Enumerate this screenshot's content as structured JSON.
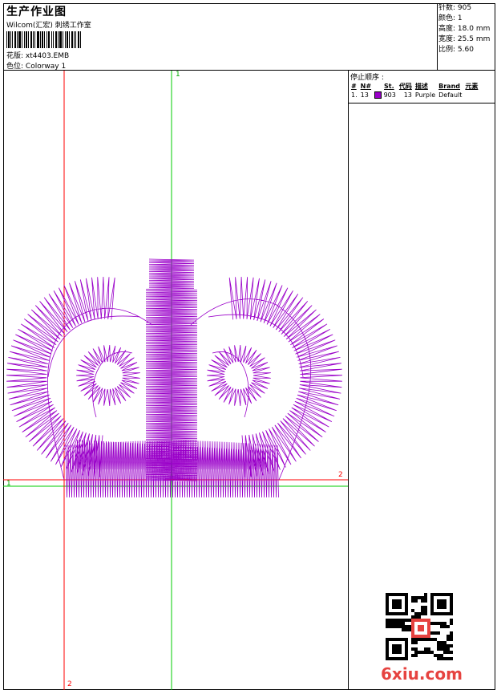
{
  "header": {
    "title": "生产作业图",
    "company": "Wilcom(汇宏) 刺绣工作室",
    "design_label": "花版",
    "design_name": "xt4403.EMB",
    "colorway_label": "色位",
    "colorway_name": "Colorway 1"
  },
  "stats": [
    {
      "label": "针数",
      "value": "905"
    },
    {
      "label": "颜色",
      "value": "1"
    },
    {
      "label": "高度",
      "value": "18.0 mm"
    },
    {
      "label": "宽度",
      "value": "25.5 mm"
    },
    {
      "label": "比例",
      "value": "5.60"
    }
  ],
  "stop_sequence": {
    "title": "停止顺序 :",
    "columns": [
      "#",
      "N#",
      "St.",
      "代码",
      "描述",
      "Brand",
      "元素"
    ],
    "rows": [
      {
        "num": "1.",
        "needle": "13",
        "stitches": "903",
        "code": "13",
        "description": "Purple",
        "brand": "Default",
        "color": "#9a00c9"
      }
    ]
  },
  "guides": {
    "green_vertical": "1",
    "green_horizontal": "1",
    "red_horizontal": "2",
    "red_vertical": "2"
  },
  "colors": {
    "thread": "#9a00c9",
    "red_guide": "#ff0000",
    "green_guide": "#00cc00",
    "brand": "#e64340"
  },
  "watermark": {
    "text": "6xiu.com"
  }
}
